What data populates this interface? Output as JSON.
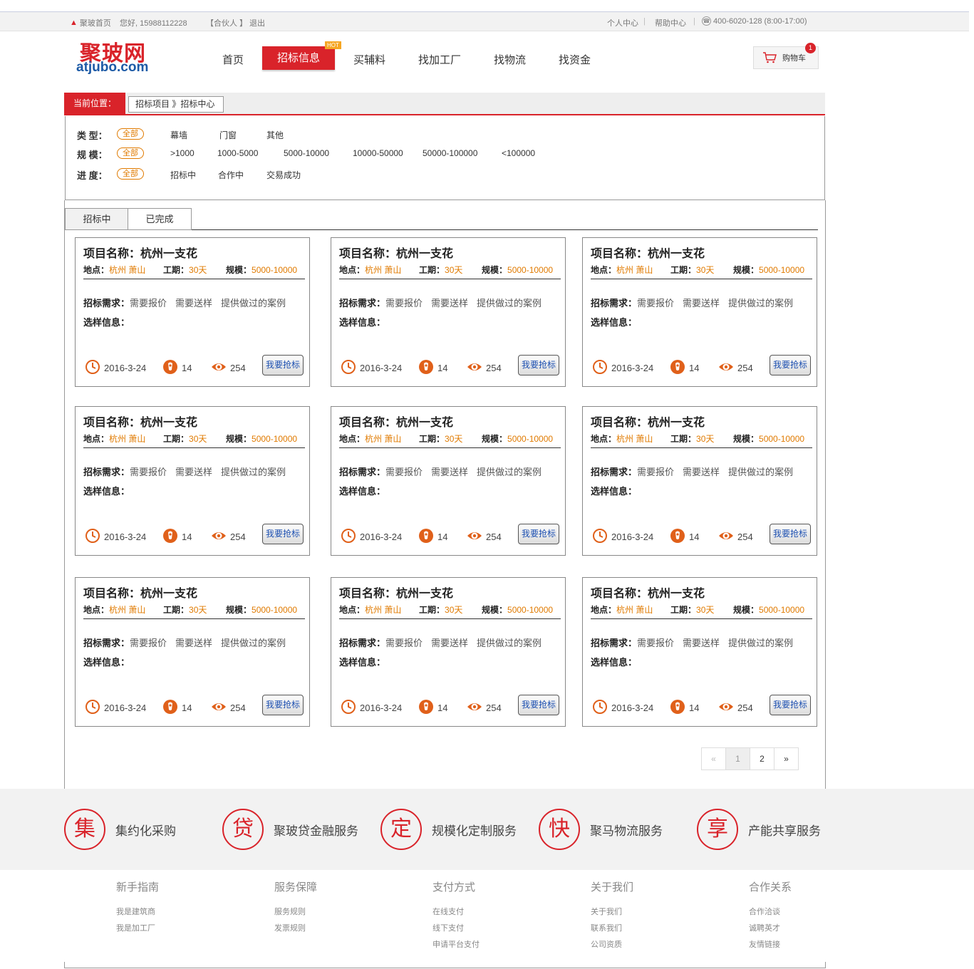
{
  "topbar": {
    "home": "聚玻首页",
    "greeting": "您好, 15988112228",
    "partner": "【合伙人 】",
    "logout": "退出",
    "user_center": "个人中心",
    "help_center": "帮助中心",
    "phone": "400-6020-128 (8:00-17:00)"
  },
  "logo": {
    "cn": "聚玻网",
    "en": "atjubo.com"
  },
  "nav": {
    "home": "首页",
    "bidding": "招标信息",
    "hot": "HOT",
    "materials": "买辅料",
    "factory": "找加工厂",
    "logistics": "找物流",
    "funding": "找资金"
  },
  "cart": {
    "label": "购物车",
    "count": "1"
  },
  "breadcrumb": {
    "label": "当前位置：",
    "path": "招标项目 》招标中心"
  },
  "filters": {
    "type": {
      "label": "类  型：",
      "all": "全部",
      "options": [
        "幕墙",
        "门窗",
        "其他"
      ]
    },
    "scale": {
      "label": "规  模：",
      "all": "全部",
      "options": [
        ">1000",
        "1000-5000",
        "5000-10000",
        "10000-50000",
        "50000-100000",
        "<100000"
      ]
    },
    "progress": {
      "label": "进  度：",
      "all": "全部",
      "options": [
        "招标中",
        "合作中",
        "交易成功"
      ]
    }
  },
  "tabs": [
    "招标中",
    "已完成"
  ],
  "card_template": {
    "name_label": "项目名称：",
    "location_label": "地点：",
    "period_label": "工期：",
    "scale_label": "规模：",
    "req_label": "招标需求：",
    "sample_label": "选样信息：",
    "button": "我要抢标"
  },
  "cards": [
    {
      "name": "杭州一支花",
      "location": "杭州 萧山",
      "period": "30天",
      "scale": "5000-10000",
      "reqs": [
        "需要报价",
        "需要送样",
        "提供做过的案例"
      ],
      "date": "2016-3-24",
      "bids": "14",
      "views": "254"
    },
    {
      "name": "杭州一支花",
      "location": "杭州 萧山",
      "period": "30天",
      "scale": "5000-10000",
      "reqs": [
        "需要报价",
        "需要送样",
        "提供做过的案例"
      ],
      "date": "2016-3-24",
      "bids": "14",
      "views": "254"
    },
    {
      "name": "杭州一支花",
      "location": "杭州 萧山",
      "period": "30天",
      "scale": "5000-10000",
      "reqs": [
        "需要报价",
        "需要送样",
        "提供做过的案例"
      ],
      "date": "2016-3-24",
      "bids": "14",
      "views": "254"
    },
    {
      "name": "杭州一支花",
      "location": "杭州 萧山",
      "period": "30天",
      "scale": "5000-10000",
      "reqs": [
        "需要报价",
        "需要送样",
        "提供做过的案例"
      ],
      "date": "2016-3-24",
      "bids": "14",
      "views": "254"
    },
    {
      "name": "杭州一支花",
      "location": "杭州 萧山",
      "period": "30天",
      "scale": "5000-10000",
      "reqs": [
        "需要报价",
        "需要送样",
        "提供做过的案例"
      ],
      "date": "2016-3-24",
      "bids": "14",
      "views": "254"
    },
    {
      "name": "杭州一支花",
      "location": "杭州 萧山",
      "period": "30天",
      "scale": "5000-10000",
      "reqs": [
        "需要报价",
        "需要送样",
        "提供做过的案例"
      ],
      "date": "2016-3-24",
      "bids": "14",
      "views": "254"
    },
    {
      "name": "杭州一支花",
      "location": "杭州 萧山",
      "period": "30天",
      "scale": "5000-10000",
      "reqs": [
        "需要报价",
        "需要送样",
        "提供做过的案例"
      ],
      "date": "2016-3-24",
      "bids": "14",
      "views": "254"
    },
    {
      "name": "杭州一支花",
      "location": "杭州 萧山",
      "period": "30天",
      "scale": "5000-10000",
      "reqs": [
        "需要报价",
        "需要送样",
        "提供做过的案例"
      ],
      "date": "2016-3-24",
      "bids": "14",
      "views": "254"
    },
    {
      "name": "杭州一支花",
      "location": "杭州 萧山",
      "period": "30天",
      "scale": "5000-10000",
      "reqs": [
        "需要报价",
        "需要送样",
        "提供做过的案例"
      ],
      "date": "2016-3-24",
      "bids": "14",
      "views": "254"
    }
  ],
  "pagination": [
    "«",
    "1",
    "2",
    "»"
  ],
  "services": [
    {
      "char": "集",
      "text": "集约化采购"
    },
    {
      "char": "贷",
      "text": "聚玻贷金融服务"
    },
    {
      "char": "定",
      "text": "规模化定制服务"
    },
    {
      "char": "快",
      "text": "聚马物流服务"
    },
    {
      "char": "享",
      "text": "产能共享服务"
    }
  ],
  "footer": [
    {
      "title": "新手指南",
      "links": [
        "我是建筑商",
        "我是加工厂"
      ]
    },
    {
      "title": "服务保障",
      "links": [
        "服务规则",
        "发票规则"
      ]
    },
    {
      "title": "支付方式",
      "links": [
        "在线支付",
        "线下支付",
        "申请平台支付"
      ]
    },
    {
      "title": "关于我们",
      "links": [
        "关于我们",
        "联系我们",
        "公司资质"
      ]
    },
    {
      "title": "合作关系",
      "links": [
        "合作洽谈",
        "诚聘英才",
        "友情链接"
      ]
    }
  ],
  "colors": {
    "brand_red": "#d9232a",
    "accent_orange": "#e07a00",
    "logo_blue": "#1c5aa6"
  }
}
